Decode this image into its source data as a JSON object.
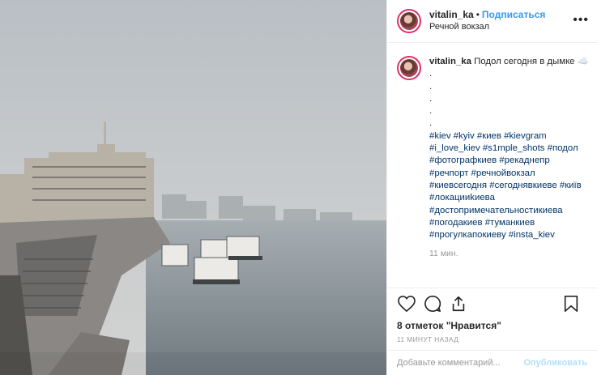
{
  "header": {
    "username": "vitalin_ka",
    "separator": "•",
    "follow_label": "Подписаться",
    "location": "Речной вокзал",
    "more_icon": "more-icon"
  },
  "caption": {
    "username": "vitalin_ka",
    "text": "Подол сегодня в дымке ☁️",
    "dots": [
      ".",
      ".",
      ".",
      ".",
      "."
    ],
    "hashtag_lines": [
      "#kiev #kyiv #киев #kievgram",
      "#i_love_kiev #s1mple_shots #подол",
      "#фотографкиев #рекаднепр",
      "#речпорт #речнойвокзал",
      "#киевсегодня #сегоднявкиеве #київ",
      "#локацииkиева",
      "#достопримечательностикиева",
      "#погодакиев #туманкиев",
      "#прогулкапокиеву #insta_kiev"
    ],
    "time": "11 мин."
  },
  "actions": {
    "icons": [
      "heart-icon",
      "comment-icon",
      "share-icon",
      "bookmark-icon"
    ]
  },
  "likes": "8 отметок \"Нравится\"",
  "timestamp": "11 МИНУТ НАЗАД",
  "comment_box": {
    "placeholder": "Добавьте комментарий...",
    "publish_label": "Опубликовать"
  },
  "colors": {
    "link_blue": "#3897f0",
    "hashtag": "#003569",
    "publish_disabled": "#b2dffc",
    "muted": "#999999"
  }
}
